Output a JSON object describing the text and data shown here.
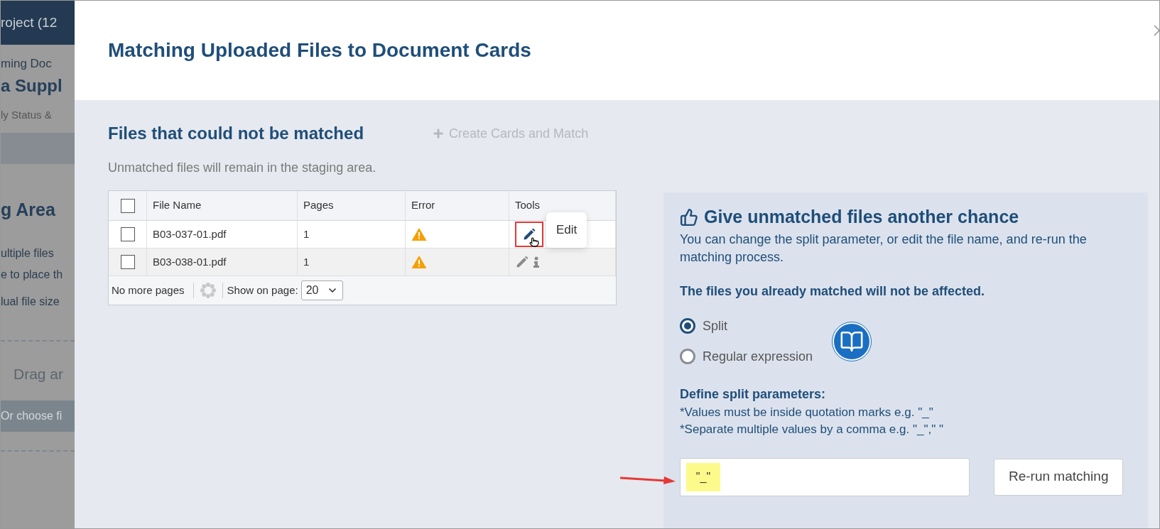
{
  "background_page": {
    "header": "roject (12",
    "breadcrumb": "ming Doc",
    "title": "a Suppl",
    "subtitle": "ly Status &",
    "section_title": "g Area",
    "lines": [
      "ultiple files",
      "e to place th",
      "lual file size"
    ],
    "drop_zone": "Drag ar",
    "choose_button": "Or choose fi"
  },
  "modal": {
    "title": "Matching Uploaded Files to Document Cards"
  },
  "unmatched": {
    "title": "Files that could not be matched",
    "action": {
      "label": "Create Cards and Match",
      "disabled": true
    },
    "note": "Unmatched files will remain in the staging area.",
    "table": {
      "columns": [
        "File Name",
        "Pages",
        "Error",
        "Tools"
      ],
      "select_all_checked": false,
      "rows": [
        {
          "file_name": "B03-037-01.pdf",
          "pages": "1",
          "checked": false,
          "hovered": true
        },
        {
          "file_name": "B03-038-01.pdf",
          "pages": "1",
          "checked": false,
          "hovered": false
        }
      ]
    },
    "tooltip": "Edit",
    "footer": {
      "status": "No more pages",
      "page_size_label": "Show on page:",
      "page_size": "20"
    }
  },
  "retry_panel": {
    "title": "Give unmatched files another chance",
    "description": "You can change the split parameter, or edit the file name, and re-run the matching process.",
    "notice": "The files you already matched will not be affected.",
    "modes": [
      {
        "label": "Split",
        "selected": true
      },
      {
        "label": "Regular expression",
        "selected": false
      }
    ],
    "params_title": "Define split parameters:",
    "hints": [
      "*Values must be inside quotation marks e.g. \"_\"",
      "*Separate multiple values by a comma e.g. \"_\",\" \""
    ],
    "value": "\"_\"",
    "button": "Re-run matching"
  }
}
